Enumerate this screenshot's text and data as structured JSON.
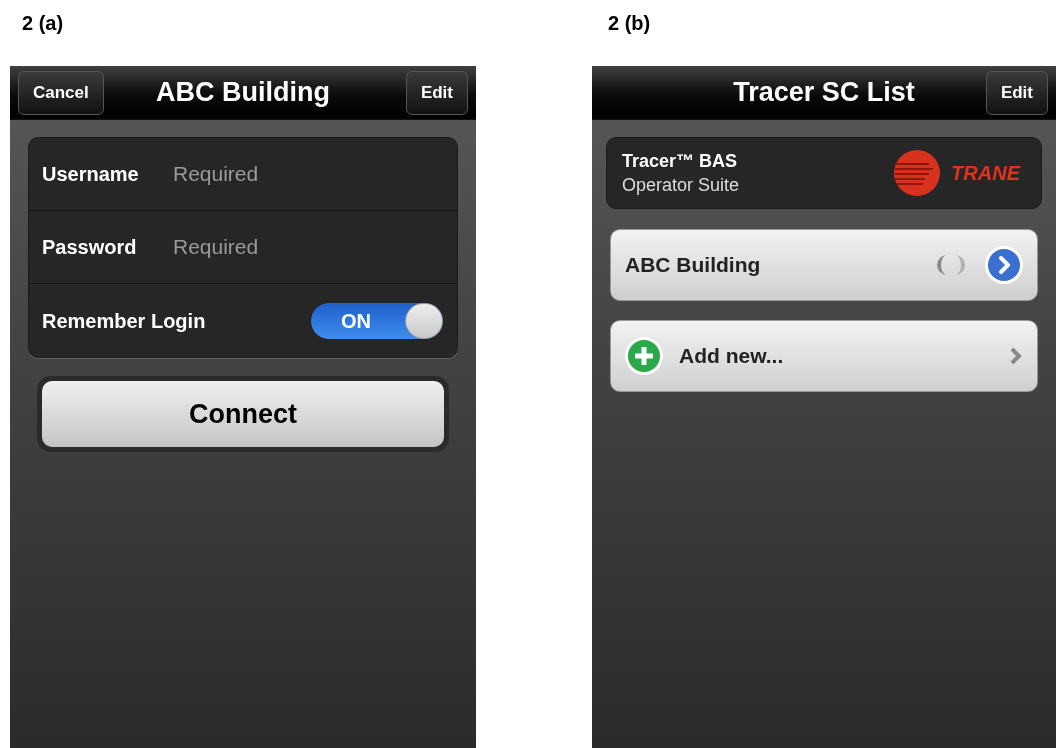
{
  "panel_a": {
    "label": "2 (a)",
    "nav": {
      "left_button": "Cancel",
      "title": "ABC Building",
      "right_button": "Edit"
    },
    "fields": [
      {
        "kind": "text",
        "label": "Username",
        "placeholder": "Required"
      },
      {
        "kind": "text",
        "label": "Password",
        "placeholder": "Required"
      },
      {
        "kind": "toggle",
        "label": "Remember Login",
        "on": true,
        "on_text": "ON"
      }
    ],
    "connect_button": "Connect"
  },
  "panel_b": {
    "label": "2 (b)",
    "nav": {
      "title": "Tracer SC List",
      "right_button": "Edit"
    },
    "header_card": {
      "title": "Tracer™ BAS",
      "subtitle": "Operator Suite",
      "logo_text": "TRANE"
    },
    "list": [
      {
        "kind": "site",
        "label": "ABC Building",
        "loading": true
      },
      {
        "kind": "add",
        "label": "Add new..."
      }
    ]
  }
}
